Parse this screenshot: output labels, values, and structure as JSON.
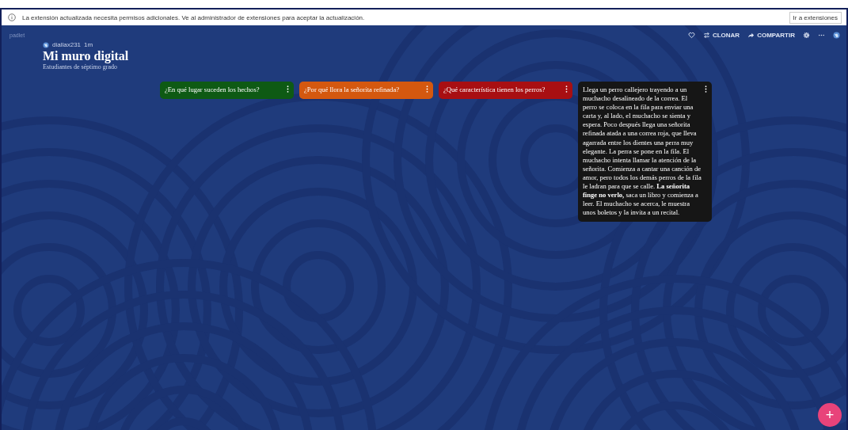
{
  "notice": {
    "message": "La extensión actualizada necesita permisos adicionales. Ve al administrador de extensiones para aceptar la actualización.",
    "button": "Ir a extensiones"
  },
  "app": {
    "logo": "padlet",
    "actions": [
      "CLONAR",
      "COMPARTIR"
    ]
  },
  "header": {
    "author": "diallax231",
    "time": "1m",
    "title": "Mi muro digital",
    "subtitle": "Estudiantes de séptimo grado"
  },
  "posts": [
    {
      "text": "¿En qué lugar suceden los hechos?",
      "color": "#0e5a14"
    },
    {
      "text": "¿Por qué llora la señorita refinada?",
      "color": "#d4580f"
    },
    {
      "text": "¿Qué característica tienen los perros?",
      "color": "#a80f12"
    },
    {
      "text": "Llega un perro callejero trayendo a un muchacho desalineado de la correa. El perro se coloca en la fila para enviar una carta y, al lado, el muchacho se sienta y espera. Poco después llega una señorita refinada atada a una correa roja, que lleva agarrada entre los dientes una perra muy elegante. La perra se pone en la fila. El muchacho intenta llamar la atención de la señorita. Comienza a cantar una canción de amor, pero todos los demás perros de la fila le ladran para que se calle. **La señorita finge no verlo,** saca un libro y comienza a leer. El muchacho se acerca, le muestra unos boletos y la invita a un recital.",
      "color": "#161616"
    }
  ],
  "fab": "+"
}
